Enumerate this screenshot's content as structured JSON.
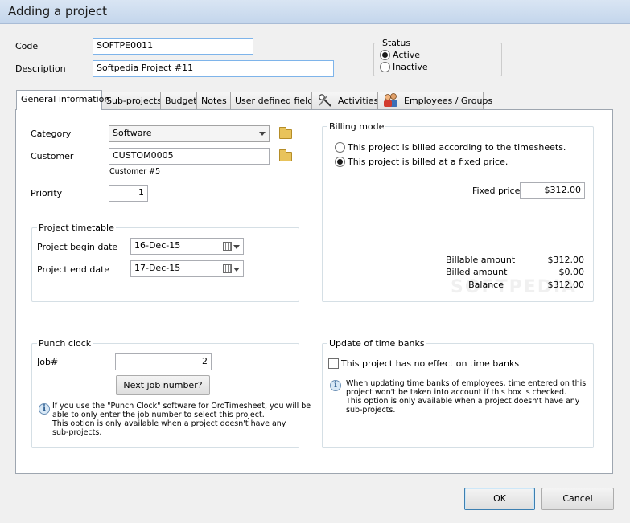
{
  "window": {
    "title": "Adding a project"
  },
  "form": {
    "code_label": "Code",
    "code_value": "SOFTPE0011",
    "description_label": "Description",
    "description_value": "Softpedia Project #11"
  },
  "status": {
    "title": "Status",
    "active_label": "Active",
    "inactive_label": "Inactive",
    "selected": "Active"
  },
  "tabs": [
    {
      "label": "General information"
    },
    {
      "label": "Sub-projects"
    },
    {
      "label": "Budget"
    },
    {
      "label": "Notes"
    },
    {
      "label": "User defined fields"
    },
    {
      "label": "Activities"
    },
    {
      "label": "Employees / Groups"
    }
  ],
  "general": {
    "category_label": "Category",
    "category_value": "Software",
    "customer_label": "Customer",
    "customer_value": "CUSTOM0005",
    "customer_name": "Customer #5",
    "priority_label": "Priority",
    "priority_value": "1"
  },
  "timetable": {
    "title": "Project timetable",
    "begin_label": "Project begin date",
    "begin_value": "16-Dec-15",
    "end_label": "Project end date",
    "end_value": "17-Dec-15"
  },
  "billing": {
    "title": "Billing mode",
    "option_timesheets": "This project is billed according to the timesheets.",
    "option_fixed": "This project is billed at a fixed price.",
    "selected": "fixed",
    "fixed_price_label": "Fixed price",
    "fixed_price_value": "$312.00",
    "billable_label": "Billable amount",
    "billable_value": "$312.00",
    "billed_label": "Billed amount",
    "billed_value": "$0.00",
    "balance_label": "Balance",
    "balance_value": "$312.00"
  },
  "punch": {
    "title": "Punch clock",
    "job_label": "Job#",
    "job_value": "2",
    "next_button": "Next job number?",
    "info_line1": "If you use the \"Punch Clock\" software for OroTimesheet, you will be",
    "info_line2": "able to only enter the job number to select this project.",
    "info_line3": "This option is only available when a project doesn't have any",
    "info_line4": "sub-projects."
  },
  "timebanks": {
    "title": "Update of time banks",
    "checkbox_label": "This project has no effect on time banks",
    "checked": false,
    "info_line1": "When updating time banks of employees, time entered on this",
    "info_line2": "project won't be taken into account if this box is checked.",
    "info_line3": "This option is only available when a project doesn't have any",
    "info_line4": "sub-projects."
  },
  "buttons": {
    "ok": "OK",
    "cancel": "Cancel"
  },
  "watermark": "SOFTPEDIA"
}
